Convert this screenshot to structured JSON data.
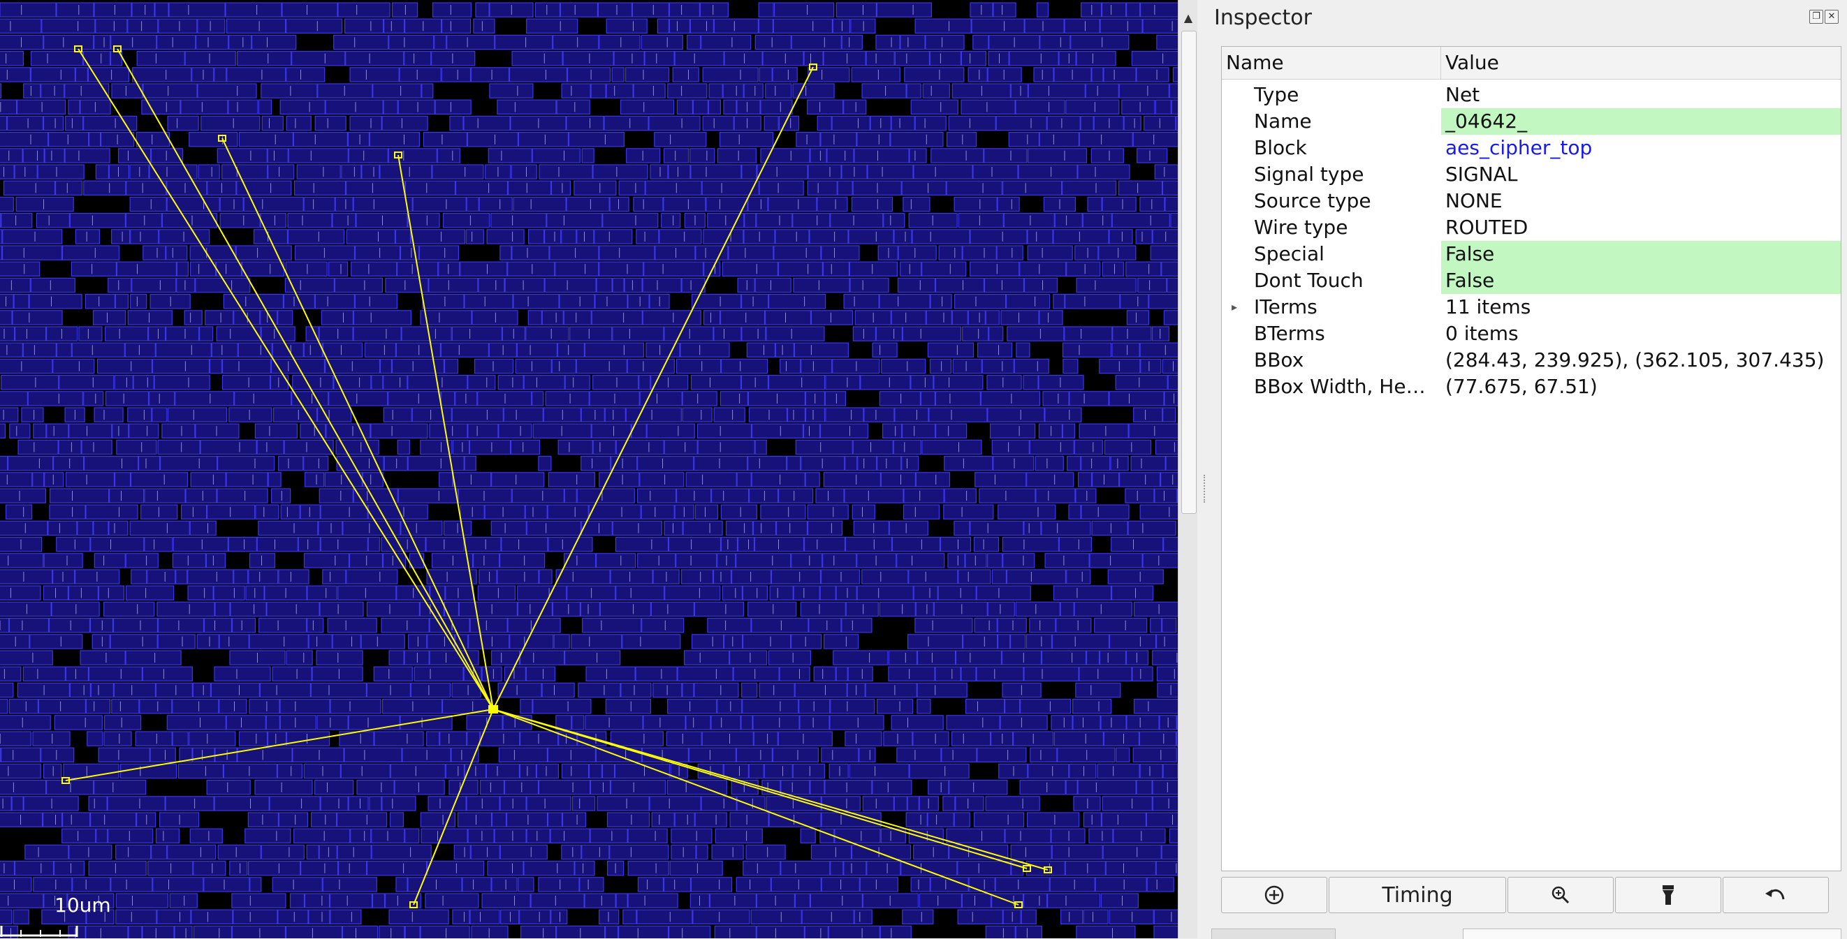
{
  "layout_view": {
    "scale_label": "10um"
  },
  "inspector": {
    "title": "Inspector",
    "columns": {
      "name": "Name",
      "value": "Value"
    },
    "properties": [
      {
        "name": "Type",
        "value": "Net",
        "highlight": false,
        "link": false,
        "expandable": false
      },
      {
        "name": "Name",
        "value": "_04642_",
        "highlight": true,
        "link": false,
        "expandable": false
      },
      {
        "name": "Block",
        "value": "aes_cipher_top",
        "highlight": false,
        "link": true,
        "expandable": false
      },
      {
        "name": "Signal type",
        "value": "SIGNAL",
        "highlight": false,
        "link": false,
        "expandable": false
      },
      {
        "name": "Source type",
        "value": "NONE",
        "highlight": false,
        "link": false,
        "expandable": false
      },
      {
        "name": "Wire type",
        "value": "ROUTED",
        "highlight": false,
        "link": false,
        "expandable": false
      },
      {
        "name": "Special",
        "value": "False",
        "highlight": true,
        "link": false,
        "expandable": false
      },
      {
        "name": "Dont Touch",
        "value": "False",
        "highlight": true,
        "link": false,
        "expandable": false
      },
      {
        "name": "ITerms",
        "value": "11 items",
        "highlight": false,
        "link": false,
        "expandable": true
      },
      {
        "name": "BTerms",
        "value": "0 items",
        "highlight": false,
        "link": false,
        "expandable": false
      },
      {
        "name": "BBox",
        "value": "(284.43, 239.925), (362.105, 307.435)",
        "highlight": false,
        "link": false,
        "expandable": false
      },
      {
        "name": "BBox Width, He…",
        "value": "(77.675, 67.51)",
        "highlight": false,
        "link": false,
        "expandable": false
      }
    ],
    "toolbar": {
      "focus_icon": "zoom-in-circle-icon",
      "timing_label": "Timing",
      "zoom_icon": "magnifier-icon",
      "highlight_icon": "flashlight-icon",
      "undo_icon": "undo-icon"
    }
  },
  "colors": {
    "layout_background": "#000000",
    "cell_fill": "#17127a",
    "cell_outline": "#3b36e6",
    "net_highlight": "#ffff00",
    "value_highlight": "#c2f7c2",
    "link": "#1a1ae6"
  }
}
